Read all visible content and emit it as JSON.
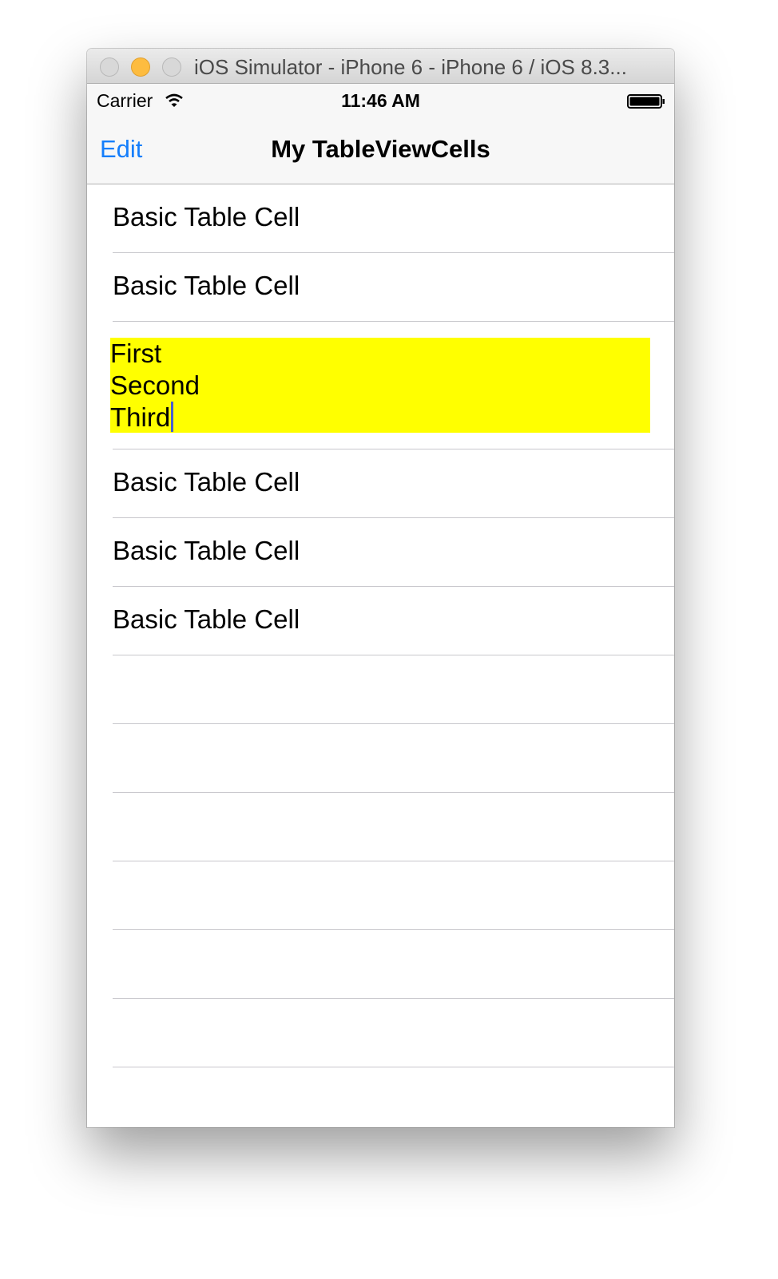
{
  "window": {
    "title": "iOS Simulator - iPhone 6 - iPhone 6 / iOS 8.3..."
  },
  "status_bar": {
    "carrier": "Carrier",
    "time": "11:46 AM"
  },
  "nav_bar": {
    "edit_label": "Edit",
    "title": "My TableViewCells"
  },
  "table": {
    "cells": [
      "Basic Table Cell",
      "Basic Table Cell",
      "Basic Table Cell",
      "Basic Table Cell",
      "Basic Table Cell"
    ],
    "text_view_lines": [
      "First",
      "Second",
      "Third"
    ]
  },
  "colors": {
    "tint": "#157efb",
    "text_view_background": "#ffff00"
  }
}
